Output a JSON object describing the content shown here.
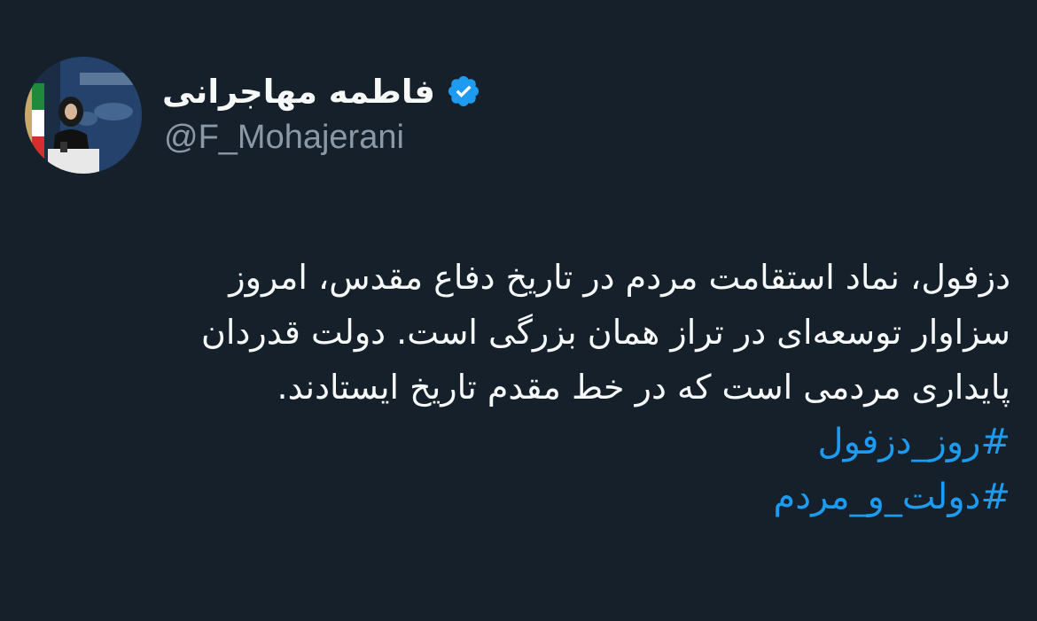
{
  "author": {
    "display_name": "فاطمه مهاجرانی",
    "handle": "@F_Mohajerani",
    "verified": true,
    "avatar_icon": "profile-photo"
  },
  "tweet": {
    "lines": [
      "دزفول، نماد استقامت مردم  در تاریخ دفاع مقدس، امروز",
      "سزاوار توسعه‌ای در تراز همان بزرگی است. دولت قدردان",
      "پایداری مردمی است که در خط مقدم تاریخ ایستادند."
    ],
    "hashtags": [
      "#روز_دزفول",
      "#دولت_و_مردم"
    ]
  },
  "colors": {
    "background": "#15202b",
    "text": "#f7f9f9",
    "secondary_text": "#8b98a5",
    "accent": "#1d9bf0"
  }
}
